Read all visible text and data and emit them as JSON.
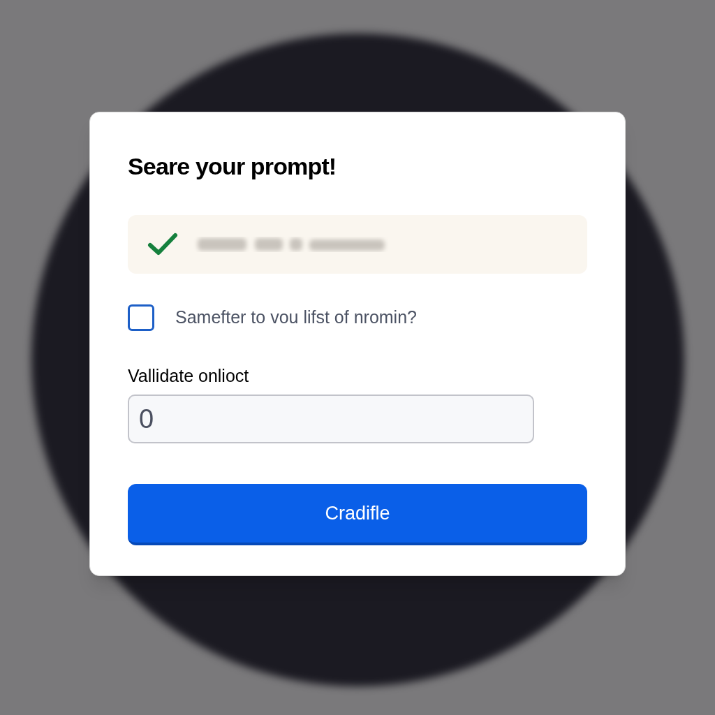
{
  "dialog": {
    "title": "Seare your prompt!",
    "alert": {
      "kind": "success"
    },
    "checkbox": {
      "label": "Samefter to vou lifst of nromin?",
      "checked": false
    },
    "field": {
      "label": "Vallidate onlioct",
      "value": "0"
    },
    "button": {
      "label": "Cradifle"
    }
  }
}
